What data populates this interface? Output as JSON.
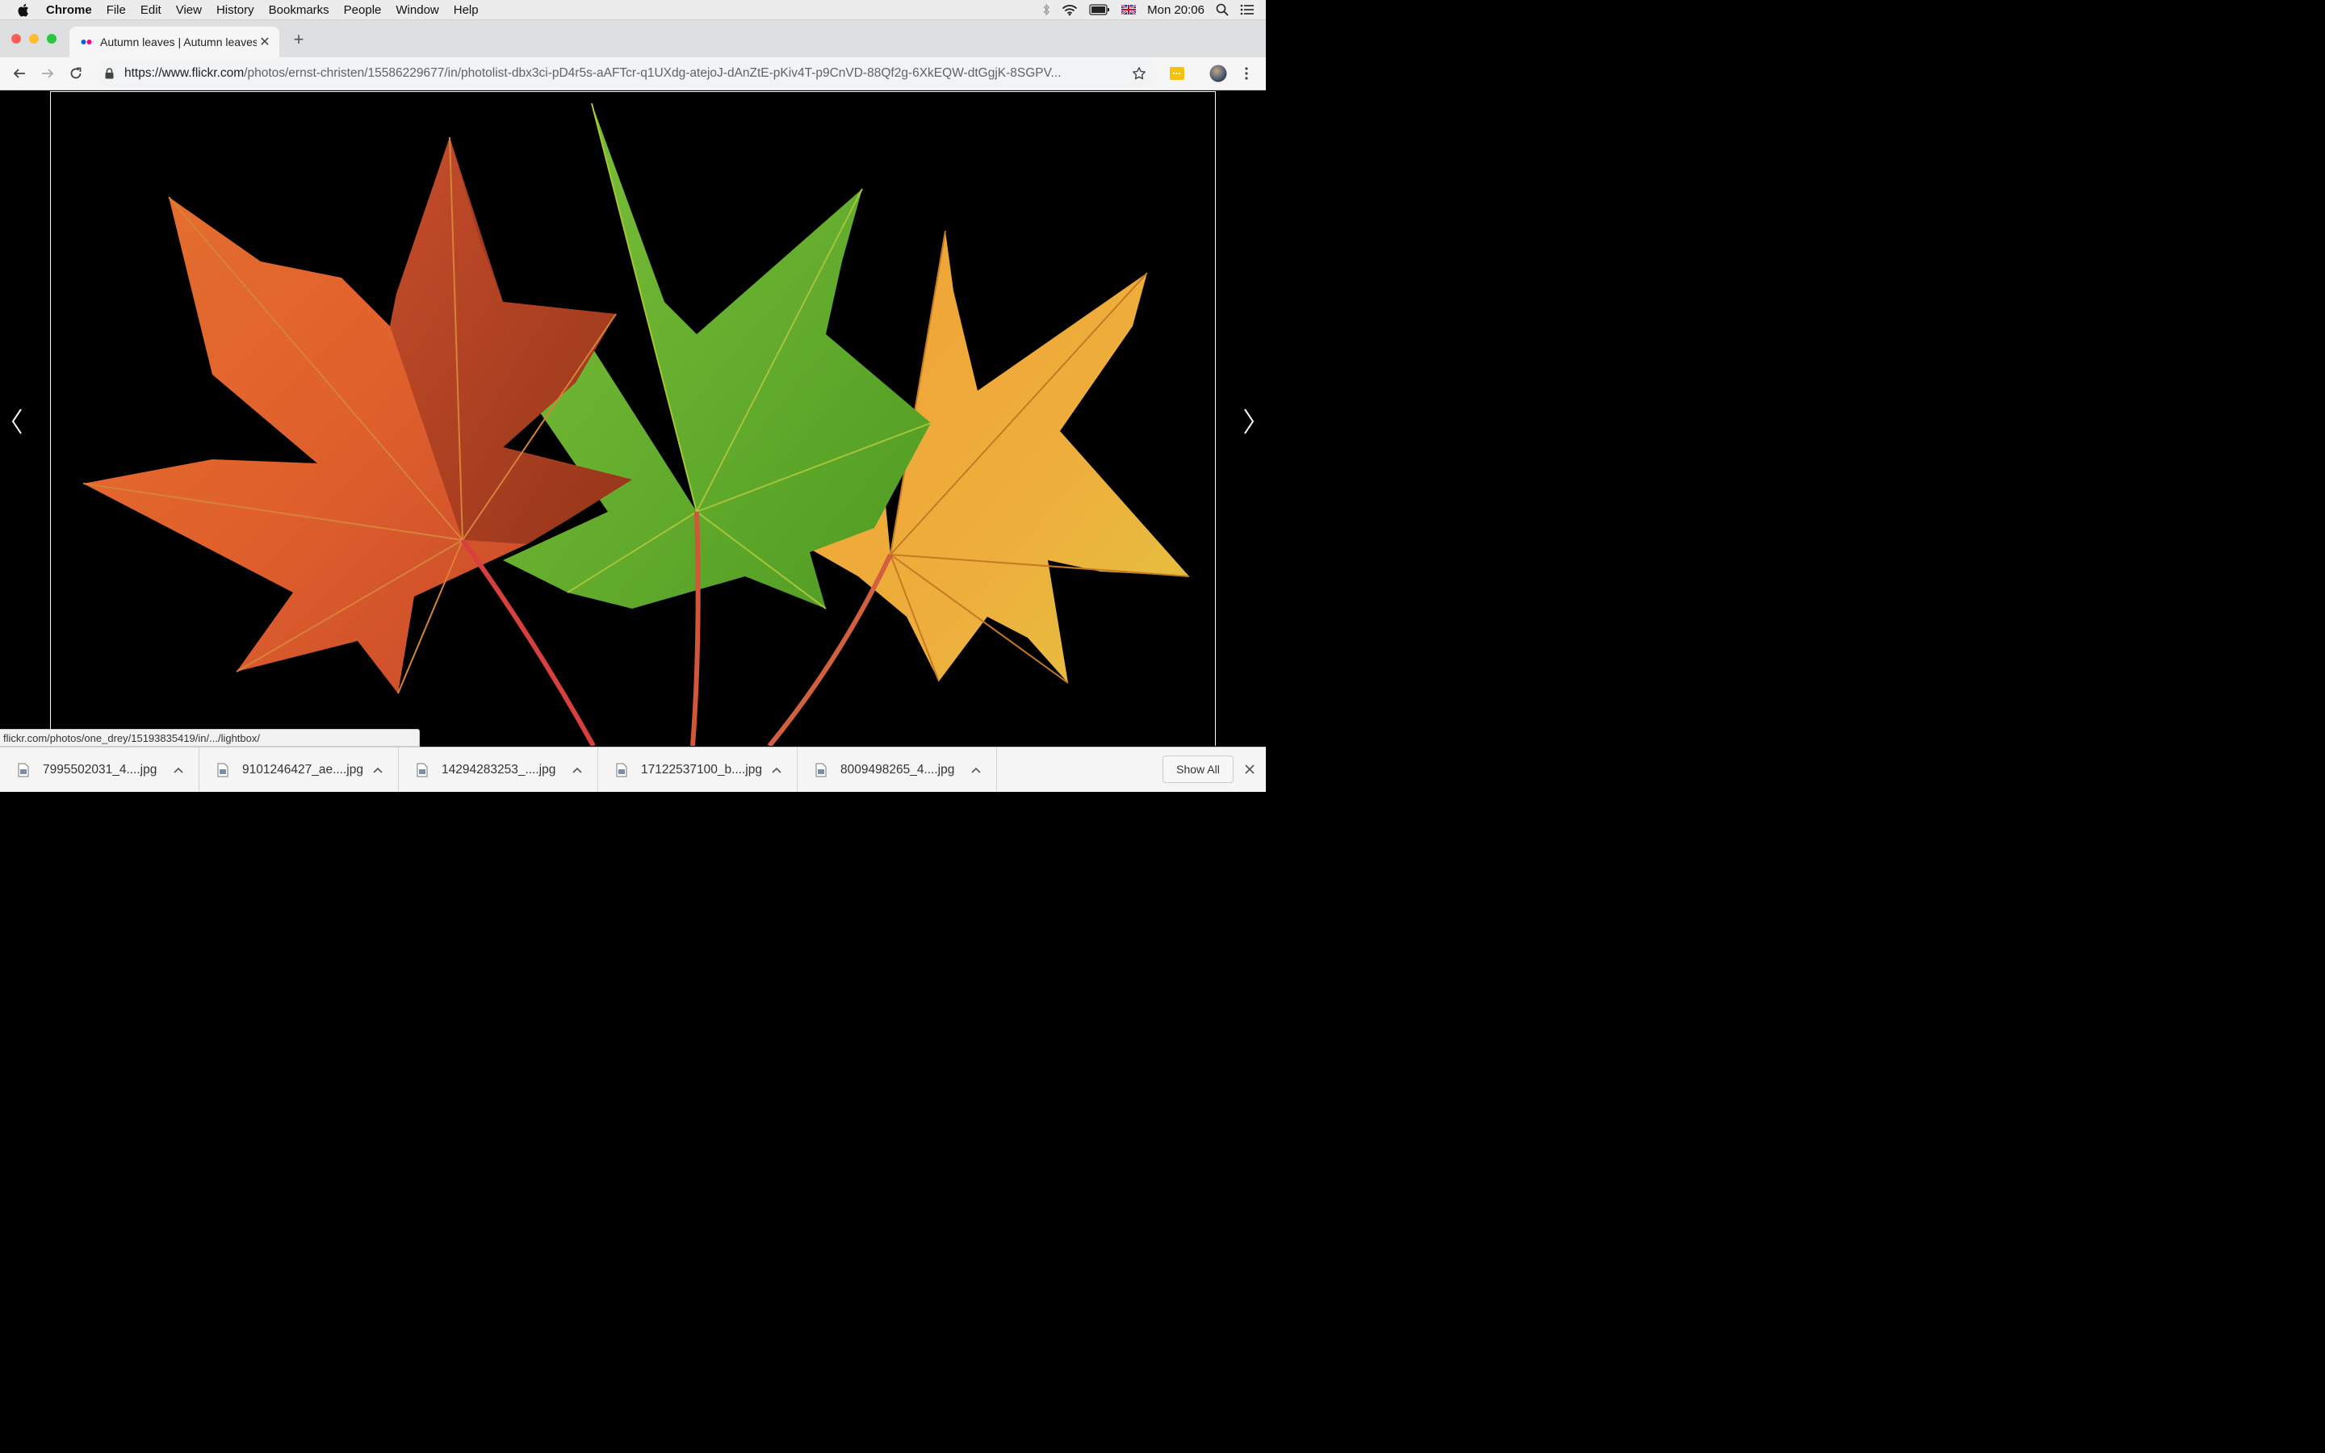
{
  "menubar": {
    "app_name": "Chrome",
    "items": [
      "File",
      "Edit",
      "View",
      "History",
      "Bookmarks",
      "People",
      "Window",
      "Help"
    ],
    "clock": "Mon 20:06"
  },
  "tab": {
    "title": "Autumn leaves | Autumn leaves",
    "new_tab_symbol": "+",
    "close_symbol": "✕"
  },
  "omnibox": {
    "url_host": "https://www.flickr.com",
    "url_rest": "/photos/ernst-christen/15586229677/in/photolist-dbx3ci-pD4r5s-aAFTcr-q1UXdg-atejoJ-dAnZtE-pKiv4T-p9CnVD-88Qf2g-6XkEQW-dtGgjK-8SGPV..."
  },
  "status_bubble": "flickr.com/photos/one_drey/15193835419/in/.../lightbox/",
  "photo": {
    "description_icon": "autumn-maple-leaves-photo",
    "colors": {
      "red_leaf": "#d9532a",
      "green_leaf": "#6ab22e",
      "yellow_leaf": "#eba33a",
      "background": "#000000"
    }
  },
  "downloads": {
    "items": [
      {
        "name": "7995502031_4....jpg"
      },
      {
        "name": "9101246427_ae....jpg"
      },
      {
        "name": "14294283253_....jpg"
      },
      {
        "name": "17122537100_b....jpg"
      },
      {
        "name": "8009498265_4....jpg"
      }
    ],
    "show_all_label": "Show All"
  }
}
